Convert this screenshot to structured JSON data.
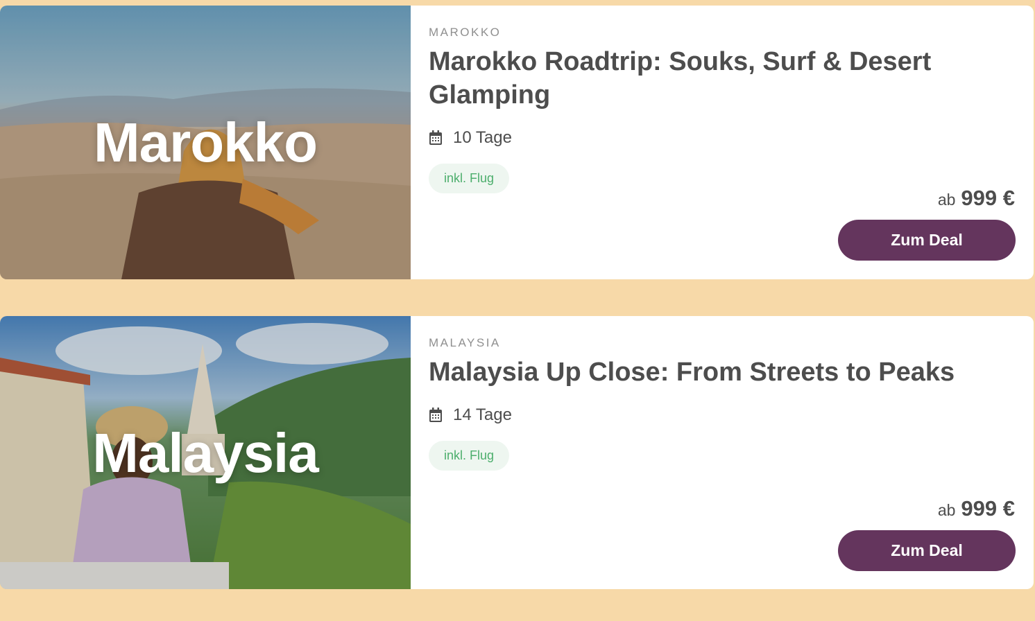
{
  "deals": [
    {
      "hero_label": "Marokko",
      "country": "MAROKKO",
      "title": "Marokko Roadtrip: Souks, Surf & Desert Glamping",
      "duration": "10 Tage",
      "badge": "inkl. Flug",
      "price_prefix": "ab",
      "price": "999 €",
      "cta": "Zum Deal",
      "image": "desert-traveler-photo"
    },
    {
      "hero_label": "Malaysia",
      "country": "MALAYSIA",
      "title": "Malaysia Up Close: From Streets to Peaks",
      "duration": "14 Tage",
      "badge": "inkl. Flug",
      "price_prefix": "ab",
      "price": "999 €",
      "cta": "Zum Deal",
      "image": "temple-view-photo"
    }
  ],
  "colors": {
    "page_bg": "#f7d9a8",
    "button": "#64355d",
    "badge_bg": "#eef6f0",
    "badge_text": "#4cae6c"
  },
  "icons": {
    "duration": "calendar-icon"
  }
}
